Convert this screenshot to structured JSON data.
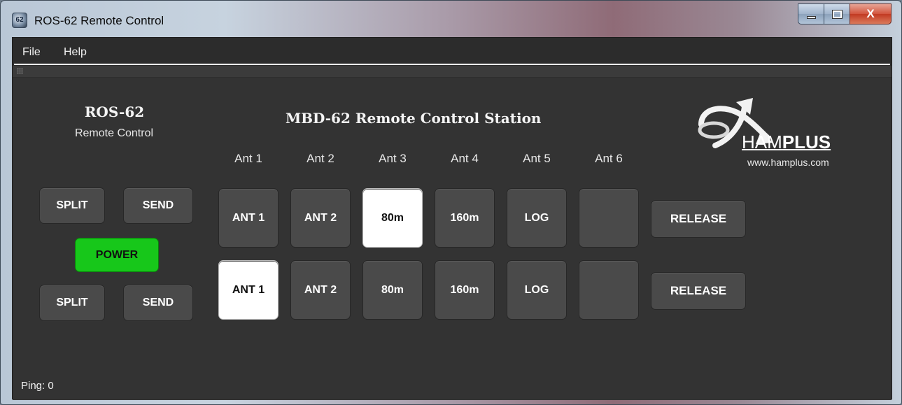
{
  "window": {
    "title": "ROS-62 Remote Control",
    "icon_text": "62",
    "icon": "app-icon",
    "caption_buttons": [
      "minimize-icon",
      "maximize-icon",
      "close-icon"
    ],
    "close_glyph": "X"
  },
  "menu": {
    "items": [
      "File",
      "Help"
    ]
  },
  "left_panel": {
    "title": "ROS-62",
    "subtitle": "Remote Control",
    "top_row": [
      "SPLIT",
      "SEND"
    ],
    "power": "POWER",
    "bottom_row": [
      "SPLIT",
      "SEND"
    ],
    "power_color": "#17c71a"
  },
  "station": {
    "title": "MBD-62 Remote Control Station",
    "antenna_labels": [
      "Ant 1",
      "Ant 2",
      "Ant 3",
      "Ant 4",
      "Ant 5",
      "Ant 6"
    ],
    "row1": {
      "buttons": [
        "ANT 1",
        "ANT 2",
        "80m",
        "160m",
        "LOG",
        ""
      ],
      "selected_index": 2,
      "release": "RELEASE"
    },
    "row2": {
      "buttons": [
        "ANT 1",
        "ANT 2",
        "80m",
        "160m",
        "LOG",
        ""
      ],
      "selected_index": 0,
      "release": "RELEASE"
    }
  },
  "logo": {
    "brand_light": "HAM",
    "brand_bold": "PLUS",
    "url": "www.hamplus.com",
    "icon": "hamplus-logo-icon"
  },
  "status": {
    "ping": "Ping: 0"
  }
}
